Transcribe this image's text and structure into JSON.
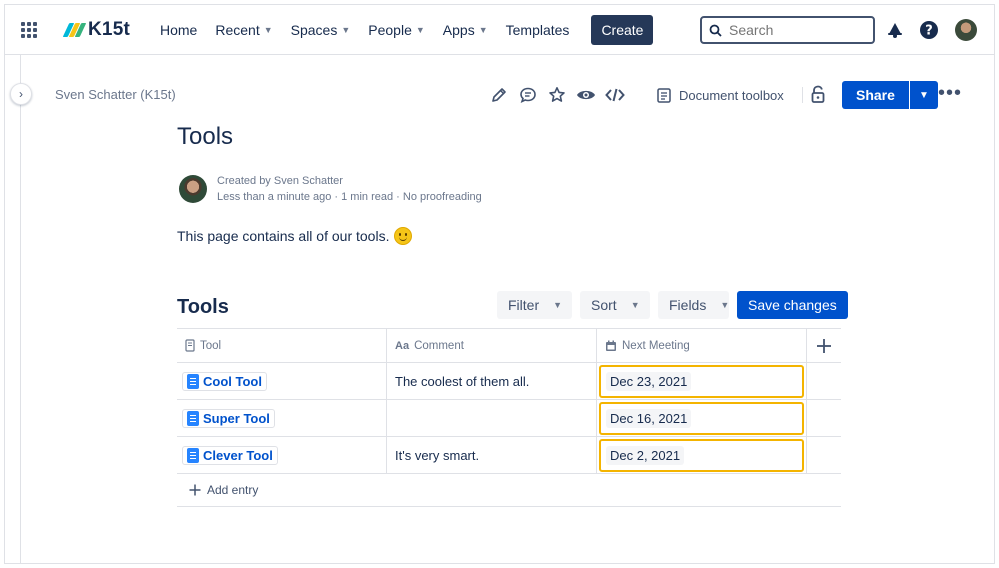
{
  "nav": {
    "logo_text": "K15t",
    "items": [
      {
        "label": "Home",
        "has_menu": false
      },
      {
        "label": "Recent",
        "has_menu": true
      },
      {
        "label": "Spaces",
        "has_menu": true
      },
      {
        "label": "People",
        "has_menu": true
      },
      {
        "label": "Apps",
        "has_menu": true
      },
      {
        "label": "Templates",
        "has_menu": false
      }
    ],
    "create_label": "Create",
    "search_placeholder": "Search",
    "icons": [
      "apps-grid-icon",
      "notifications-icon",
      "help-icon",
      "profile-avatar"
    ]
  },
  "page_header": {
    "breadcrumb": "Sven Schatter (K15t)",
    "toolbar_icons": [
      "edit-icon",
      "comment-icon",
      "star-icon",
      "watch-icon",
      "code-icon"
    ],
    "document_toolbox_label": "Document toolbox",
    "share_label": "Share"
  },
  "page": {
    "title": "Tools",
    "byline": {
      "created_by": "Created by Sven Schatter",
      "meta": "Less than a minute ago · 1 min read · No proofreading"
    },
    "intro": "This page contains all of our tools."
  },
  "database": {
    "title": "Tools",
    "filter_label": "Filter",
    "sort_label": "Sort",
    "fields_label": "Fields",
    "save_label": "Save changes",
    "columns": [
      {
        "label": "Tool",
        "icon": "page-icon"
      },
      {
        "label": "Comment",
        "icon": "text-type-icon"
      },
      {
        "label": "Next Meeting",
        "icon": "calendar-icon"
      }
    ],
    "rows": [
      {
        "tool": "Cool Tool",
        "comment": "The coolest of them all.",
        "next_meeting": "Dec 23, 2021"
      },
      {
        "tool": "Super Tool",
        "comment": "",
        "next_meeting": "Dec 16, 2021"
      },
      {
        "tool": "Clever Tool",
        "comment": "It's very smart.",
        "next_meeting": "Dec 2, 2021"
      }
    ],
    "add_entry_label": "Add entry"
  },
  "colors": {
    "primary": "#0052cc",
    "text": "#172b4d",
    "subtle": "#6b778c",
    "highlight_border": "#f4b400",
    "create_button": "#253858"
  }
}
